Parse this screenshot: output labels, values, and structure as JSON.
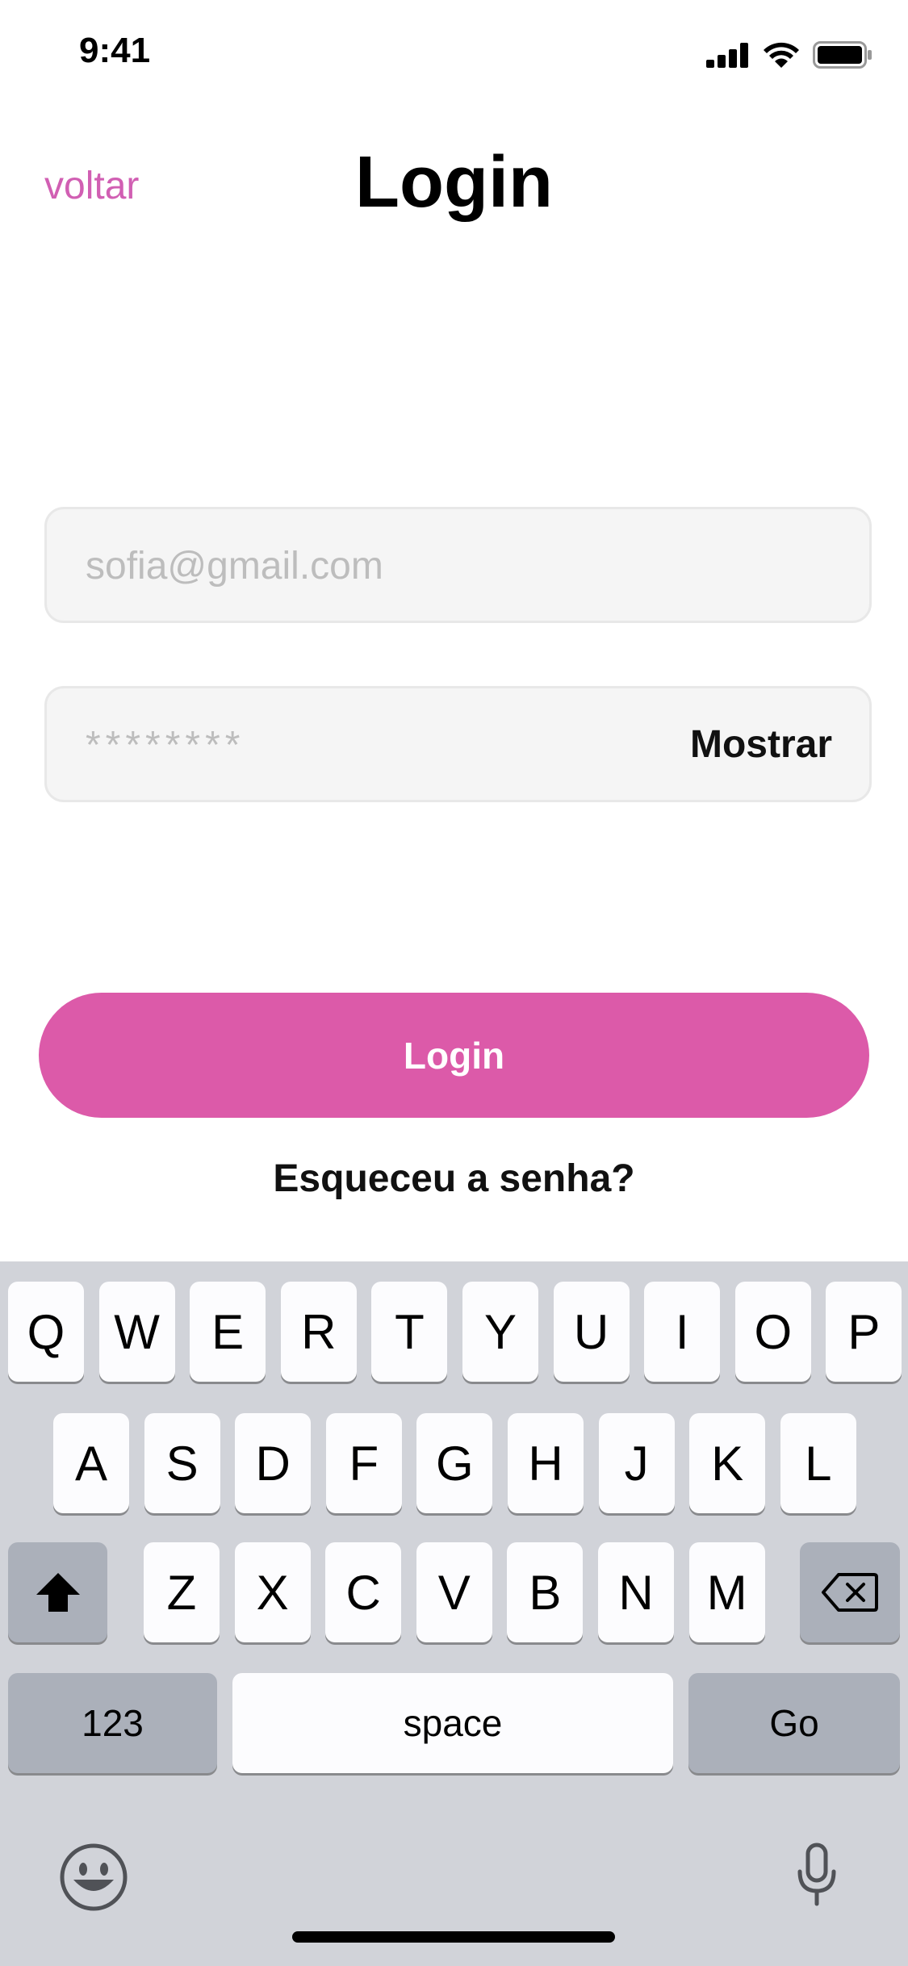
{
  "status_bar": {
    "time": "9:41"
  },
  "header": {
    "back_label": "voltar",
    "title": "Login"
  },
  "form": {
    "email_placeholder": "sofia@gmail.com",
    "password_placeholder": "********",
    "show_label": "Mostrar"
  },
  "login_button_label": "Login",
  "forgot_link": "Esqueceu a senha?",
  "colors": {
    "accent": "#dc5aa9",
    "back_link": "#d15fb3",
    "keyboard_bg": "#d1d3d9"
  },
  "keyboard": {
    "row1": [
      "Q",
      "W",
      "E",
      "R",
      "T",
      "Y",
      "U",
      "I",
      "O",
      "P"
    ],
    "row2": [
      "A",
      "S",
      "D",
      "F",
      "G",
      "H",
      "J",
      "K",
      "L"
    ],
    "row3": [
      "Z",
      "X",
      "C",
      "V",
      "B",
      "N",
      "M"
    ],
    "numbers_label": "123",
    "space_label": "space",
    "go_label": "Go",
    "icons": [
      "shift-icon",
      "backspace-icon",
      "emoji-icon",
      "microphone-icon"
    ]
  }
}
